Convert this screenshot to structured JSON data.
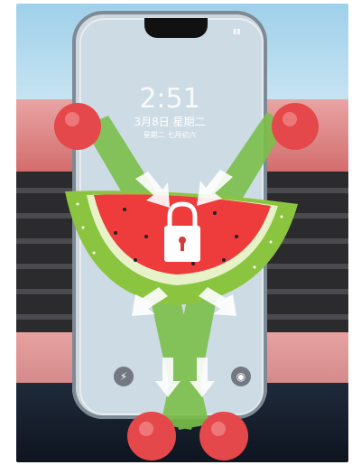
{
  "lock_screen": {
    "time": "2:51",
    "date": "3月8日 星期二",
    "sub": "星期二 七月初六"
  },
  "colors": {
    "grip_ball": "#e5484a",
    "arm_green": "#7bbf4a",
    "watermelon_red": "#ee3b3b",
    "rind_green": "#8bc53f",
    "arrow": "#ffffff"
  },
  "icons": {
    "center": "padlock-icon",
    "dock_left": "flashlight-icon",
    "dock_right": "camera-icon"
  }
}
